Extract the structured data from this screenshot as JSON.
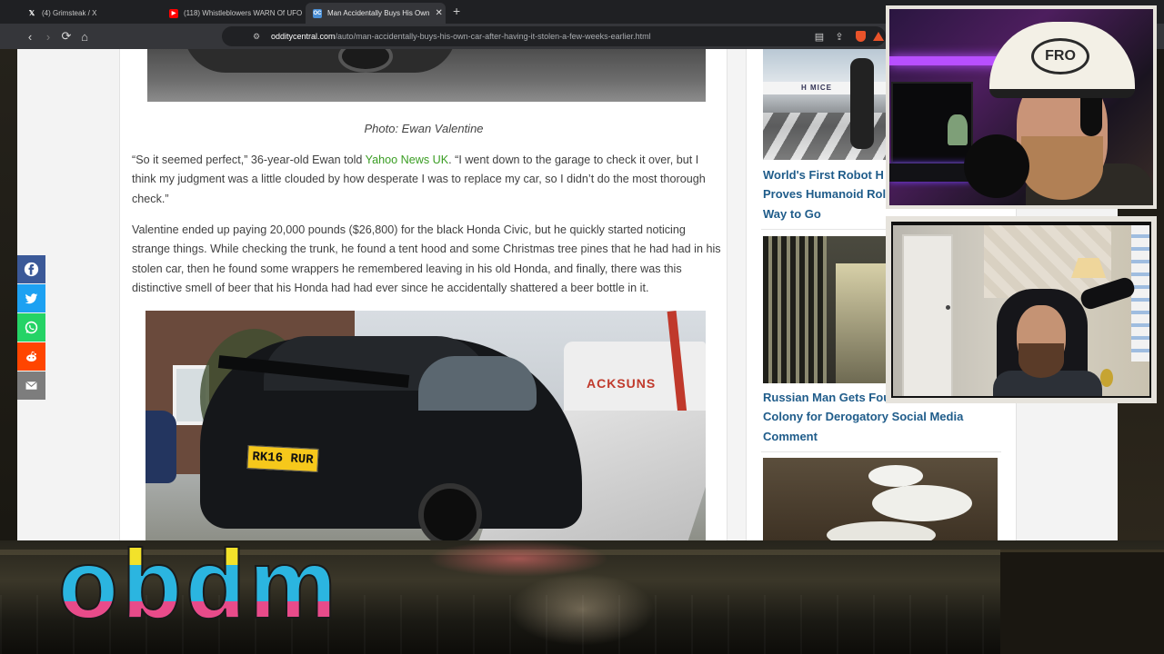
{
  "browser": {
    "tabs": [
      {
        "title": "(4) Grimsteak / X",
        "favicon": "X",
        "active": false
      },
      {
        "title": "(118) Whistleblowers WARN Of UFO",
        "favicon": "youtube",
        "active": false
      },
      {
        "title": "Man Accidentally Buys His Own",
        "favicon": "OC",
        "active": true
      }
    ],
    "url_host": "odditycentral.com",
    "url_path": "/auto/man-accidentally-buys-his-own-car-after-having-it-stolen-a-few-weeks-earlier.html"
  },
  "article": {
    "caption": "Photo: Ewan Valentine",
    "p1_before": "“So it seemed perfect,” 36-year-old Ewan told ",
    "p1_link": "Yahoo News UK",
    "p1_after": ". “I went down to the garage to check it over, but I think my judgment was a little clouded by how desperate I was to replace my car, so I didn’t do the most thorough check.”",
    "p2": "Valentine ended up paying 20,000 pounds ($26,800) for the black Honda Civic, but he quickly started noticing strange things. While checking the trunk, he found a tent hood and some Christmas tree pines that he had had in his stolen car, then he found some wrappers he remembered leaving in his old Honda, and finally, there was this distinctive smell of beer that his Honda had had ever since he accidentally shattered a beer bottle in it.",
    "plate": "RK16 RUR",
    "van_text": "ACKSUNS"
  },
  "sidebar": {
    "robot_banner": "H MICE",
    "item1": "World's First Robot H\nProves Humanoid Rol\nWay to Go",
    "item2": "Russian Man Gets Fou\nColony for Derogatory Social Media\nComment"
  },
  "share": [
    {
      "name": "facebook",
      "color": "#3b5998"
    },
    {
      "name": "twitter",
      "color": "#1da1f2"
    },
    {
      "name": "whatsapp",
      "color": "#25d366"
    },
    {
      "name": "reddit",
      "color": "#ff4500"
    },
    {
      "name": "email",
      "color": "#7d7d7d"
    }
  ],
  "overlay": {
    "logo_text": "obdm",
    "cap_text": "FRO"
  }
}
